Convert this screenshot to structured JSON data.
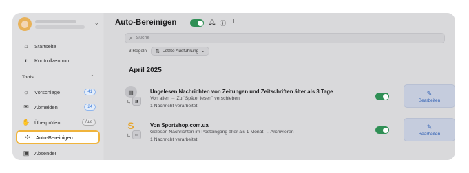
{
  "sidebar": {
    "items_top": [
      {
        "label": "Startseite",
        "icon": "home-icon"
      },
      {
        "label": "Kontrollzentrum",
        "icon": "toggle-icon"
      }
    ],
    "section_label": "Tools",
    "items_tools": [
      {
        "label": "Vorschläge",
        "icon": "lightbulb-icon",
        "badge": "41"
      },
      {
        "label": "Abmelden",
        "icon": "unsubscribe-icon",
        "badge": "24"
      },
      {
        "label": "Überprüfen",
        "icon": "hand-icon",
        "badge": "Aus"
      },
      {
        "label": "Auto-Bereinigen",
        "icon": "sparkle-icon"
      },
      {
        "label": "Absender",
        "icon": "sender-icon"
      }
    ]
  },
  "header": {
    "title": "Auto-Bereinigen",
    "toggle_on": true
  },
  "search": {
    "placeholder": "Suche"
  },
  "filters": {
    "rules_count": "3 Regeln",
    "sort_label": "Letzte Ausführung"
  },
  "month": "April 2025",
  "rules": [
    {
      "title": "Ungelesen Nachrichten von Zeitungen und Zeitschriften älter als 3 Tage",
      "description": "Von allen → Zu \"Später lesen\" verschieben",
      "count": "1 Nachricht verarbeitet",
      "enabled": true,
      "edit_label": "Bearbeiten"
    },
    {
      "icon_letter": "S",
      "title": "Von Sportshop.com.ua",
      "description": "Gelesen Nachrichten im Posteingang älter als 1 Monat → Archivieren",
      "count": "1 Nachricht verarbeitet",
      "enabled": true,
      "edit_label": "Bearbeiten"
    }
  ],
  "colors": {
    "accent_green": "#2f8f55",
    "highlight_orange": "#f0b43c",
    "link_blue": "#2f5fb3"
  }
}
